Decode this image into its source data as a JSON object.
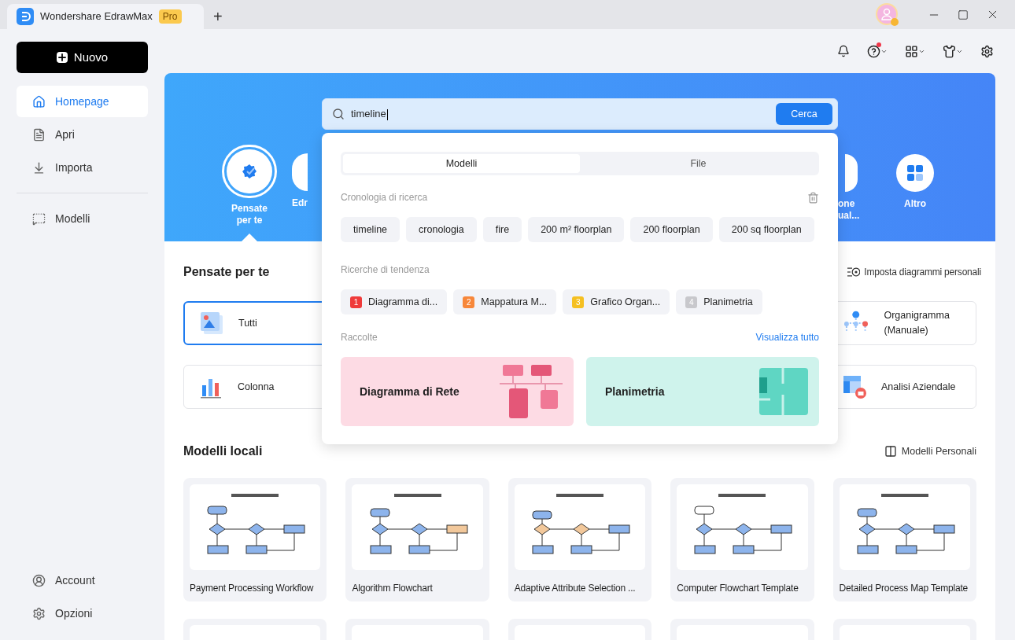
{
  "titlebar": {
    "app_name": "Wondershare EdrawMax",
    "badge": "Pro",
    "new_tab": "+"
  },
  "sidebar": {
    "new_button": "Nuovo",
    "items": [
      {
        "label": "Homepage",
        "selected": true,
        "kind": "home"
      },
      {
        "label": "Apri",
        "selected": false,
        "kind": "file"
      },
      {
        "label": "Importa",
        "selected": false,
        "kind": "import"
      },
      {
        "label": "Modelli",
        "selected": false,
        "kind": "templates"
      }
    ],
    "bottom_items": [
      {
        "label": "Account",
        "kind": "account"
      },
      {
        "label": "Opzioni",
        "kind": "options"
      }
    ]
  },
  "header": {
    "help_has_notification": true
  },
  "hero": {
    "left_items": [
      {
        "label": "Pensate per te",
        "selected": true,
        "kind": "sparkle"
      },
      {
        "label": "Edr",
        "selected": false,
        "kind": "partial"
      }
    ],
    "right_items": [
      {
        "label": "one ual...",
        "selected": false,
        "kind": "partial"
      },
      {
        "label": "Altro",
        "selected": false,
        "kind": "grid"
      }
    ]
  },
  "search": {
    "value": "timeline",
    "button": "Cerca"
  },
  "dropdown": {
    "tabs": [
      {
        "label": "Modelli",
        "selected": true
      },
      {
        "label": "File",
        "selected": false
      }
    ],
    "history_title": "Cronologia di ricerca",
    "history": [
      "timeline",
      "cronologia",
      "fire",
      "200 m² floorplan",
      "200 floorplan",
      "200 sq floorplan"
    ],
    "trending_title": "Ricerche di tendenza",
    "trending": [
      {
        "rank": "1",
        "label": "Diagramma di...",
        "color": "#ef3b3b"
      },
      {
        "rank": "2",
        "label": "Mappatura M...",
        "color": "#f7873a"
      },
      {
        "rank": "3",
        "label": "Grafico Organ...",
        "color": "#f5c022"
      },
      {
        "rank": "4",
        "label": "Planimetria",
        "color": "#c8c8cc"
      }
    ],
    "collections_title": "Raccolte",
    "collections_link": "Visualizza tutto",
    "collections": [
      {
        "title": "Diagramma di Rete",
        "kind": "network"
      },
      {
        "title": "Planimetria",
        "kind": "floorplan"
      }
    ]
  },
  "suggested": {
    "title": "Pensate per te",
    "link": "Imposta diagrammi personali",
    "rows": [
      {
        "cards": [
          {
            "label": "Tutti",
            "kind": "all",
            "selected": true
          },
          {
            "label": "Organigramma (Manuale)",
            "kind": "org",
            "selected": false
          }
        ]
      },
      {
        "cards": [
          {
            "label": "Colonna",
            "kind": "column",
            "selected": false
          },
          {
            "label": "Analisi Aziendale",
            "kind": "business",
            "selected": false
          }
        ]
      }
    ]
  },
  "local": {
    "title": "Modelli locali",
    "link": "Modelli Personali",
    "templates": [
      {
        "title": "Payment Processing Workflow"
      },
      {
        "title": "Algorithm Flowchart"
      },
      {
        "title": "Adaptive Attribute Selection ..."
      },
      {
        "title": "Computer Flowchart Template"
      },
      {
        "title": "Detailed Process Map Template"
      }
    ]
  }
}
